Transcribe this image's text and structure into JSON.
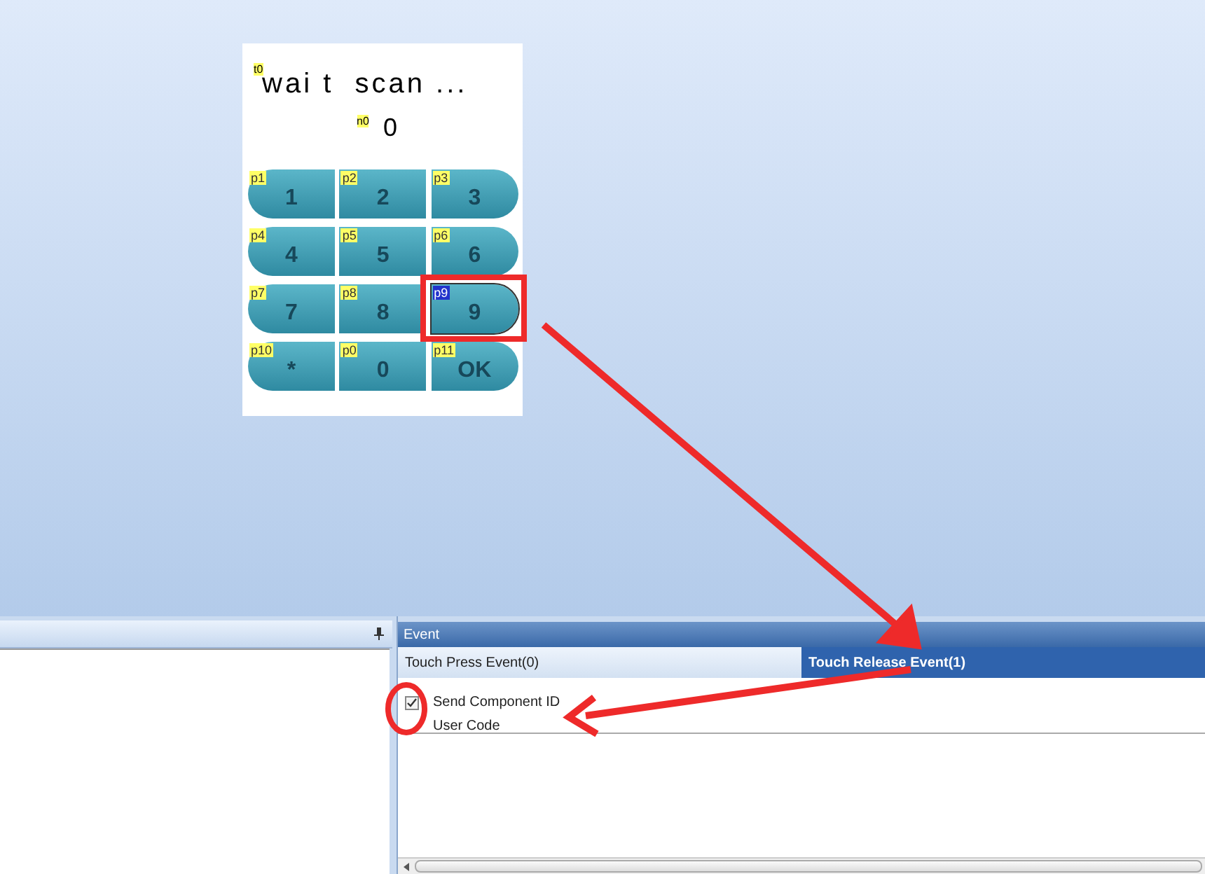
{
  "device_screen": {
    "title": {
      "tag": "t0",
      "text": "wai t  scan ..."
    },
    "number": {
      "tag": "n0",
      "value": "0"
    },
    "keys": [
      {
        "tag": "p1",
        "label": "1",
        "selected": false
      },
      {
        "tag": "p2",
        "label": "2",
        "selected": false
      },
      {
        "tag": "p3",
        "label": "3",
        "selected": false
      },
      {
        "tag": "p4",
        "label": "4",
        "selected": false
      },
      {
        "tag": "p5",
        "label": "5",
        "selected": false
      },
      {
        "tag": "p6",
        "label": "6",
        "selected": false
      },
      {
        "tag": "p7",
        "label": "7",
        "selected": false
      },
      {
        "tag": "p8",
        "label": "8",
        "selected": false
      },
      {
        "tag": "p9",
        "label": "9",
        "selected": true
      },
      {
        "tag": "p10",
        "label": "*",
        "selected": false
      },
      {
        "tag": "p0",
        "label": "0",
        "selected": false
      },
      {
        "tag": "p11",
        "label": "OK",
        "selected": false
      }
    ]
  },
  "event_panel": {
    "title": "Event",
    "tabs": [
      {
        "label": "Touch Press Event(0)",
        "selected": false
      },
      {
        "label": "Touch Release Event(1)",
        "selected": true
      }
    ],
    "send_component_id": {
      "label": "Send Component ID",
      "checked": true
    },
    "user_code_label": "User Code"
  }
}
